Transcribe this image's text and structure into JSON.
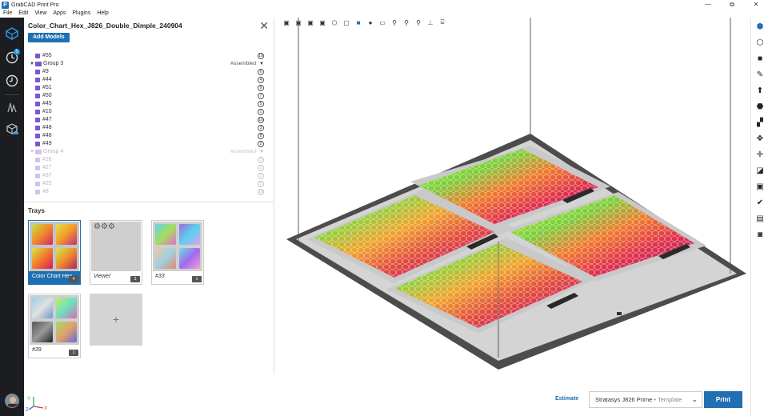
{
  "app": {
    "title": "GrabCAD Print Pro"
  },
  "menu": [
    "File",
    "Edit",
    "View",
    "Apps",
    "Plugins",
    "Help"
  ],
  "window": {
    "minimize": "—",
    "restore": "⧉",
    "close": "✕"
  },
  "leftbar": {
    "notification_badge": "5"
  },
  "project": {
    "title": "Color_Chart_Hex_J826_Double_Dimple_240904",
    "add_models": "Add Models"
  },
  "tree": [
    {
      "label": "#55",
      "count": "10",
      "type": "item",
      "indent": 1
    },
    {
      "label": "Group 3",
      "status": "Assembled",
      "type": "group"
    },
    {
      "label": "#9",
      "count": "6",
      "type": "item",
      "indent": 2
    },
    {
      "label": "#44",
      "count": "4",
      "type": "item",
      "indent": 2
    },
    {
      "label": "#51",
      "count": "9",
      "type": "item",
      "indent": 2
    },
    {
      "label": "#50",
      "count": "7",
      "type": "item",
      "indent": 2
    },
    {
      "label": "#45",
      "count": "5",
      "type": "item",
      "indent": 2
    },
    {
      "label": "#10",
      "count": "1",
      "type": "item",
      "indent": 2
    },
    {
      "label": "#47",
      "count": "10",
      "type": "item",
      "indent": 2
    },
    {
      "label": "#48",
      "count": "3",
      "type": "item",
      "indent": 2
    },
    {
      "label": "#46",
      "count": "8",
      "type": "item",
      "indent": 2
    },
    {
      "label": "#49",
      "count": "2",
      "type": "item",
      "indent": 2
    },
    {
      "label": "Group 4",
      "status": "Assembled",
      "type": "group",
      "faded": true
    },
    {
      "label": "#28",
      "count": "1",
      "type": "item",
      "indent": 2,
      "faded": true
    },
    {
      "label": "#27",
      "count": "2",
      "type": "item",
      "indent": 2,
      "faded": true
    },
    {
      "label": "#37",
      "count": "3",
      "type": "item",
      "indent": 2,
      "faded": true
    },
    {
      "label": "#25",
      "count": "5",
      "type": "item",
      "indent": 2,
      "faded": true
    },
    {
      "label": "#8",
      "count": "10",
      "type": "item",
      "indent": 2,
      "faded": true
    }
  ],
  "trays": {
    "label": "Trays",
    "items": [
      {
        "name": "Color Chart Hex ...",
        "count": "4",
        "active": true
      },
      {
        "name": "Viewer",
        "count": "3",
        "active": false
      },
      {
        "name": "#33",
        "count": "1",
        "active": false
      },
      {
        "name": "#39",
        "count": "1",
        "active": false
      }
    ],
    "add": "+"
  },
  "bottom": {
    "estimate": "Estimate",
    "printer": "Stratasys J826 Prime",
    "template": " • Template",
    "print": "Print"
  },
  "colors": {
    "accent": "#1f6fb2",
    "sidebar": "#1b1d20",
    "bed": "#4a4a4a",
    "plate": "#d8d8d8"
  }
}
